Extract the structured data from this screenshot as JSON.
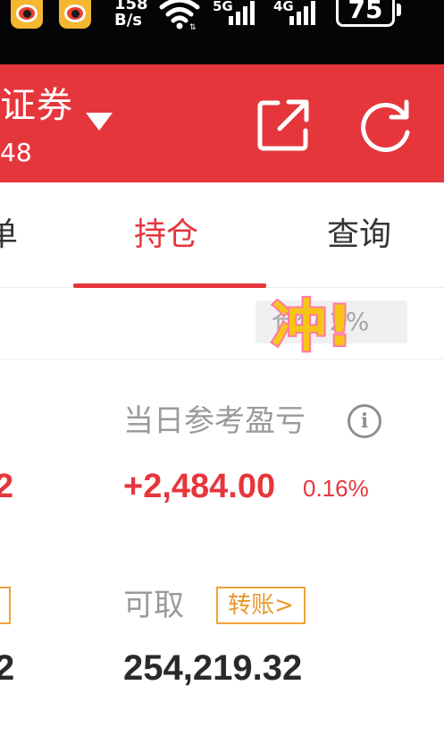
{
  "status_bar": {
    "net_speed_top": "158",
    "net_speed_bottom": "B/s",
    "sim1_label": "5G",
    "sim2_label": "4G",
    "battery": "75",
    "notification_icons": [
      "weibo-icon",
      "weibo-icon"
    ]
  },
  "header": {
    "broker_name": "证券",
    "account_suffix": "48",
    "background": "#e5363c",
    "icons": [
      "share-icon",
      "refresh-icon"
    ]
  },
  "tabs": [
    {
      "label": "单",
      "active": false
    },
    {
      "label": "持仓",
      "active": true
    },
    {
      "label": "查询",
      "active": false
    }
  ],
  "strip": {
    "chip_text": "仓位 2%",
    "sticker_text": "冲!"
  },
  "summary": {
    "daily_pnl_label": "当日参考盈亏",
    "daily_pnl_value": "+2,484.00",
    "daily_pnl_pct": "0.16%",
    "left_value_fragment": "2",
    "withdrawable_label": "可取",
    "transfer_label": "转账>",
    "withdrawable_value": "254,219.32",
    "left_value_fragment_2": "2"
  },
  "colors": {
    "accent_red": "#e5363c",
    "transfer_orange": "#f0a33a",
    "label_gray": "#9a9a9a"
  }
}
